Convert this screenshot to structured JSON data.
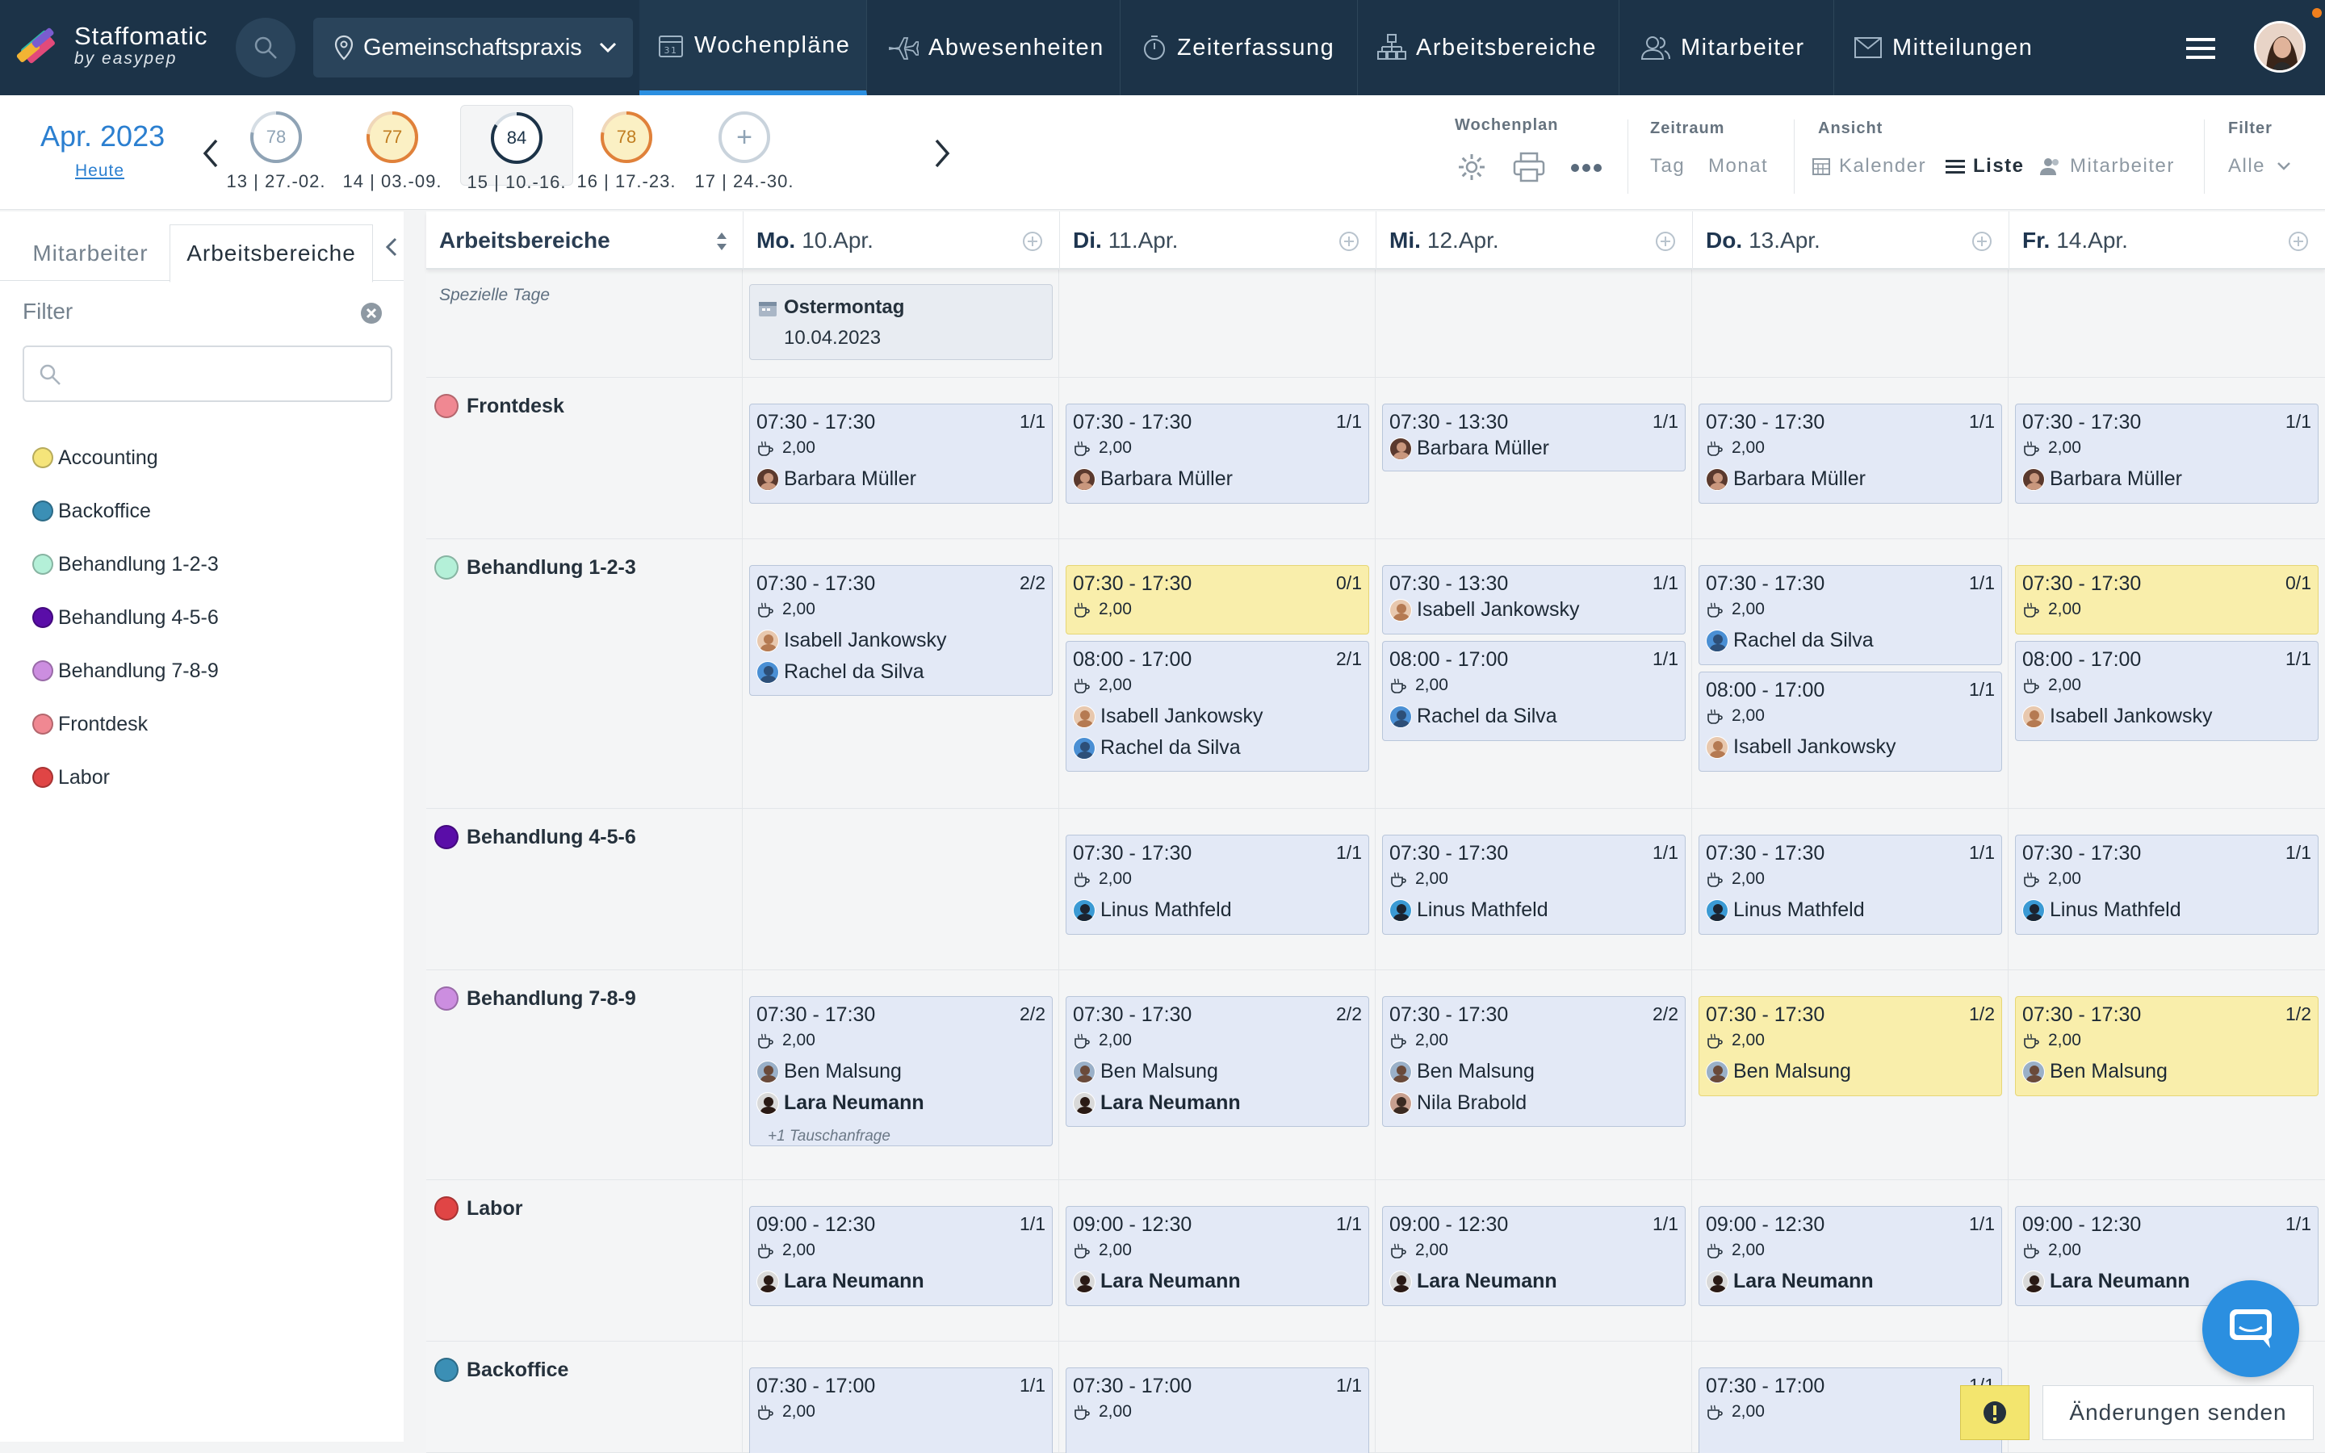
{
  "app": {
    "name": "Staffomatic",
    "sub": "by easypep"
  },
  "nav": {
    "location": "Gemeinschaftspraxis",
    "items": [
      "Wochenpläne",
      "Abwesenheiten",
      "Zeiterfassung",
      "Arbeitsbereiche",
      "Mitarbeiter",
      "Mitteilungen"
    ],
    "active": "Wochenpläne"
  },
  "weekbar": {
    "month": "Apr. 2023",
    "today": "Heute",
    "weeks": [
      {
        "score": "78",
        "label": "13 | 27.-02.",
        "color": "#8fa3b5"
      },
      {
        "score": "77",
        "label": "14 | 03.-09.",
        "color": "#e0813a"
      },
      {
        "score": "84",
        "label": "15 | 10.-16.",
        "color": "#1c3348"
      },
      {
        "score": "78",
        "label": "16 | 17.-23.",
        "color": "#e0813a"
      },
      {
        "score": "+",
        "label": "17 | 24.-30.",
        "color": "#8fa3b5"
      }
    ],
    "wochenplan_label": "Wochenplan",
    "zeitraum_label": "Zeitraum",
    "zeitraum_options": [
      "Tag",
      "Monat"
    ],
    "ansicht_label": "Ansicht",
    "ansicht_options": [
      "Kalender",
      "Liste",
      "Mitarbeiter"
    ],
    "ansicht_active": "Liste",
    "filter_label": "Filter",
    "filter_value": "Alle"
  },
  "sidebar": {
    "tabs": [
      "Mitarbeiter",
      "Arbeitsbereiche"
    ],
    "active_tab": "Arbeitsbereiche",
    "filter_label": "Filter",
    "search_value": "",
    "areas": [
      {
        "name": "Accounting",
        "color": "#f5e47a"
      },
      {
        "name": "Backoffice",
        "color": "#3b8fb5"
      },
      {
        "name": "Behandlung 1-2-3",
        "color": "#b4f0d8"
      },
      {
        "name": "Behandlung 4-5-6",
        "color": "#5a0da8"
      },
      {
        "name": "Behandlung 7-8-9",
        "color": "#cc8ee0"
      },
      {
        "name": "Frontdesk",
        "color": "#f08892"
      },
      {
        "name": "Labor",
        "color": "#e04545"
      }
    ]
  },
  "grid": {
    "first_col": "Arbeitsbereiche",
    "days": [
      {
        "dow": "Mo.",
        "date": "10.Apr."
      },
      {
        "dow": "Di.",
        "date": "11.Apr."
      },
      {
        "dow": "Mi.",
        "date": "12.Apr."
      },
      {
        "dow": "Do.",
        "date": "13.Apr."
      },
      {
        "dow": "Fr.",
        "date": "14.Apr."
      }
    ],
    "special_label": "Spezielle Tage",
    "holiday": {
      "title": "Ostermontag",
      "date": "10.04.2023"
    },
    "break_value": "2,00",
    "tausch": "+1 Tauschanfrage",
    "rows": [
      {
        "name": "Frontdesk",
        "color": "#f08892"
      },
      {
        "name": "Behandlung 1-2-3",
        "color": "#b4f0d8"
      },
      {
        "name": "Behandlung 4-5-6",
        "color": "#5a0da8"
      },
      {
        "name": "Behandlung 7-8-9",
        "color": "#cc8ee0"
      },
      {
        "name": "Labor",
        "color": "#e04545"
      },
      {
        "name": "Backoffice",
        "color": "#3b8fb5"
      }
    ],
    "shifts": [
      {
        "time": "07:30 - 17:30",
        "count": "1/1",
        "emps": [
          "Barbara Müller"
        ]
      },
      {
        "time": "07:30 - 13:30",
        "count": "1/1",
        "emps": [
          "Barbara Müller"
        ]
      },
      {
        "time": "07:30 - 17:30",
        "count": "2/2",
        "emps": [
          "Isabell Jankowsky",
          "Rachel da Silva"
        ]
      },
      {
        "time": "07:30 - 17:30",
        "count": "0/1",
        "emps": []
      },
      {
        "time": "08:00 - 17:00",
        "count": "2/1",
        "emps": [
          "Isabell Jankowsky",
          "Rachel da Silva"
        ]
      },
      {
        "time": "07:30 - 13:30",
        "count": "1/1",
        "emps": [
          "Isabell Jankowsky"
        ]
      },
      {
        "time": "08:00 - 17:00",
        "count": "1/1",
        "emps": [
          "Rachel da Silva"
        ]
      },
      {
        "time": "07:30 - 17:30",
        "count": "1/1",
        "emps": [
          "Rachel da Silva"
        ]
      },
      {
        "time": "08:00 - 17:00",
        "count": "1/1",
        "emps": [
          "Isabell Jankowsky"
        ]
      },
      {
        "time": "07:30 - 17:30",
        "count": "1/1",
        "emps": [
          "Linus Mathfeld"
        ]
      },
      {
        "time": "07:30 - 17:30",
        "count": "2/2",
        "emps": [
          "Ben Malsung",
          "Lara Neumann"
        ]
      },
      {
        "time": "07:30 - 17:30",
        "count": "2/2",
        "emps": [
          "Ben Malsung",
          "Nila Brabold"
        ]
      },
      {
        "time": "07:30 - 17:30",
        "count": "1/2",
        "emps": [
          "Ben Malsung"
        ]
      },
      {
        "time": "09:00 - 12:30",
        "count": "1/1",
        "emps": [
          "Lara Neumann"
        ]
      },
      {
        "time": "07:30 - 17:00",
        "count": "1/1",
        "emps": []
      }
    ]
  },
  "footer": {
    "send": "Änderungen senden"
  },
  "colors": {
    "accent": "#2b8fe0",
    "nav": "#1c3348",
    "shift": "#e3e9f6",
    "shift_warn": "#f9eeab"
  }
}
